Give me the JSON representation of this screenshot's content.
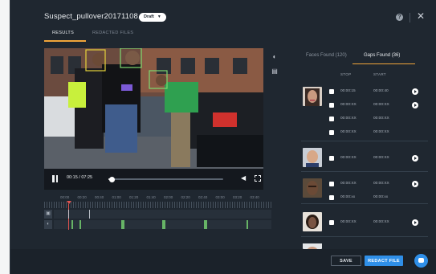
{
  "modal": {
    "title": "Suspect_pullover20171108.mp4",
    "status_badge": "Draft"
  },
  "tabs": [
    {
      "label": "RESULTS",
      "active": true
    },
    {
      "label": "REDACTED FILES",
      "active": false
    }
  ],
  "player": {
    "time_display": "00:15 / 07:25",
    "progress_fraction": 0.034
  },
  "timeline": {
    "ticks": [
      "00:00",
      "00:20",
      "00:40",
      "01:00",
      "01:20",
      "01:40",
      "02:00",
      "02:20",
      "02:40",
      "03:00",
      "03:20",
      "03:40"
    ]
  },
  "results": {
    "sub_tabs": [
      {
        "label": "Faces Found (120)",
        "active": false
      },
      {
        "label": "Gaps Found (36)",
        "active": true
      }
    ],
    "columns": {
      "stop": "STOP",
      "start": "START"
    },
    "rows": [
      {
        "stop": "00:00:15",
        "start": "00:00:40"
      },
      {
        "stop": "00:00:XX",
        "start": "00:00:XX"
      },
      {
        "stop": "00:00:XX",
        "start": "00:00:XX"
      },
      {
        "stop": "00:00:XX",
        "start": "00:00:XX"
      },
      {
        "stop": "00:00:XX",
        "start": "00:00:XX"
      },
      {
        "stop": "00:00:XX",
        "start": "00:00:XX"
      },
      {
        "stop": "00:00:xx",
        "start": "00:00:xx"
      },
      {
        "stop": "00:00:XX",
        "start": "00:00:XX"
      }
    ]
  },
  "footer": {
    "save_label": "SAVE",
    "redact_label": "REDACT FILE"
  },
  "colors": {
    "modal_bg": "#1f2730",
    "accent": "#f0a53a",
    "primary": "#2f8fe8",
    "detection_box": "#7dd96f",
    "timeline_marker": "#e0534f"
  }
}
